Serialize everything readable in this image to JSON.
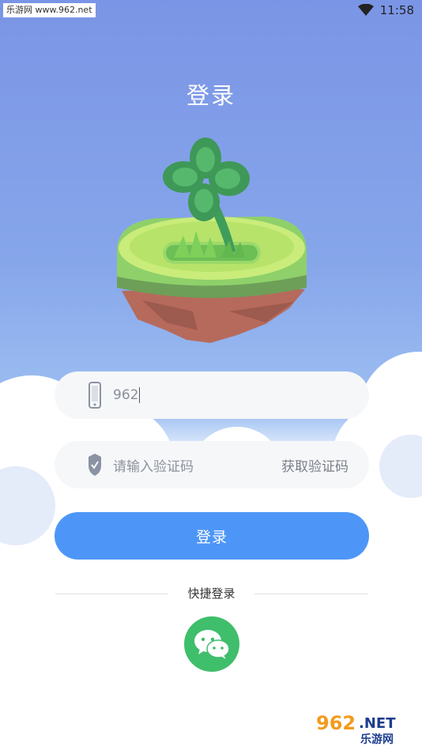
{
  "status_bar": {
    "watermark": "乐游网 www.962.net",
    "time": "11:58"
  },
  "page": {
    "title": "登录"
  },
  "phone_field": {
    "value": "962",
    "icon": "phone-icon"
  },
  "code_field": {
    "placeholder": "请输入验证码",
    "get_code_label": "获取验证码",
    "icon": "shield-icon"
  },
  "login_button": {
    "label": "登录"
  },
  "quick_login": {
    "label": "快捷登录",
    "icon": "wechat-icon",
    "color": "#3fbe6b"
  },
  "watermark_bottom": {
    "big": "962",
    "suffix": ".NET",
    "site": "乐游网"
  },
  "colors": {
    "accent": "#4d96f8",
    "background_top": "#7b95e6"
  }
}
